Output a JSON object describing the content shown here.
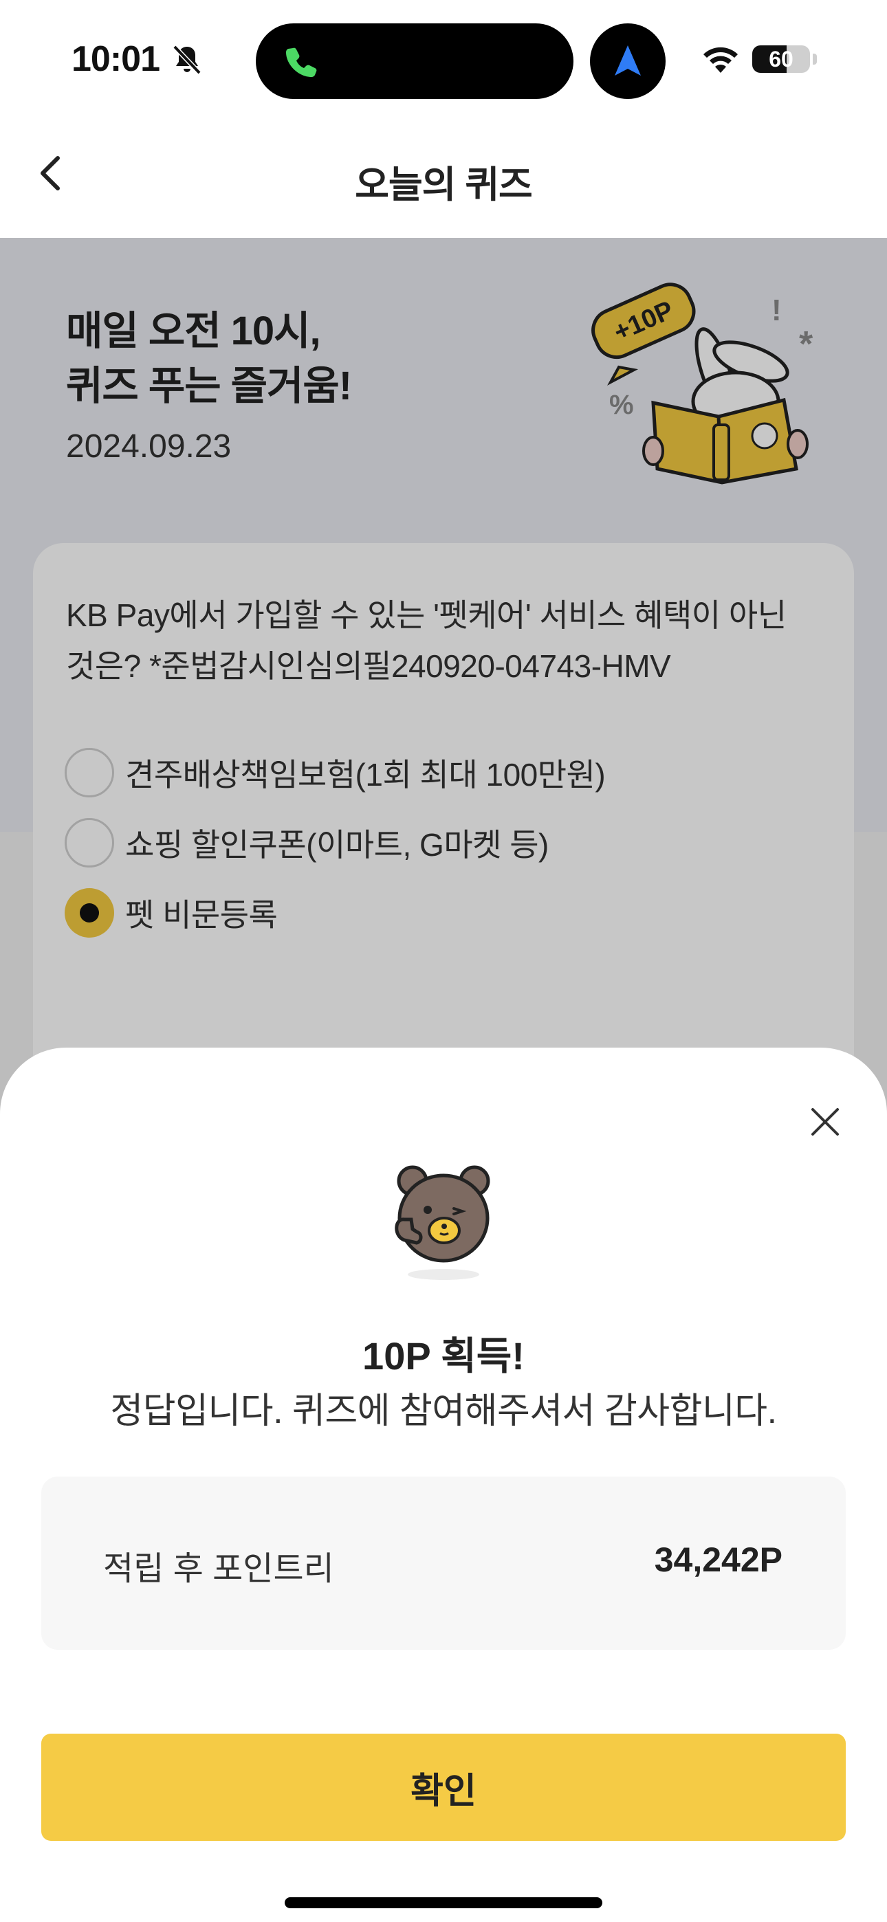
{
  "status_bar": {
    "time": "10:01",
    "battery": "60",
    "battery_level": 0.6
  },
  "header": {
    "title": "오늘의 퀴즈"
  },
  "hero": {
    "title": "매일 오전 10시,\n퀴즈 푸는 즐거움!",
    "date": "2024.09.23",
    "badge": "+10P"
  },
  "quiz": {
    "question": "KB Pay에서 가입할 수 있는 '펫케어' 서비스 혜택이 아닌 것은? *준법감시인심의필240920-04743-HMV",
    "options": [
      {
        "label": "견주배상책임보험(1회 최대 100만원)",
        "selected": false
      },
      {
        "label": "쇼핑 할인쿠폰(이마트, G마켓 등)",
        "selected": false
      },
      {
        "label": "펫 비문등록",
        "selected": true
      }
    ]
  },
  "result_sheet": {
    "title": "10P 획득!",
    "message": "정답입니다. 퀴즈에 참여해주셔서 감사합니다.",
    "points_label": "적립 후 포인트리",
    "points_value": "34,242P",
    "confirm_label": "확인"
  },
  "colors": {
    "accent": "#f5cb45",
    "selected_radio": "#f3c940",
    "hero_bg": "#e9ebf1",
    "dim_overlay": "rgba(0,0,0,0.22)"
  },
  "icons": [
    "bell-slash-icon",
    "phone-icon",
    "location-arrow-icon",
    "wifi-icon",
    "battery-icon",
    "chevron-left-icon",
    "close-icon"
  ]
}
